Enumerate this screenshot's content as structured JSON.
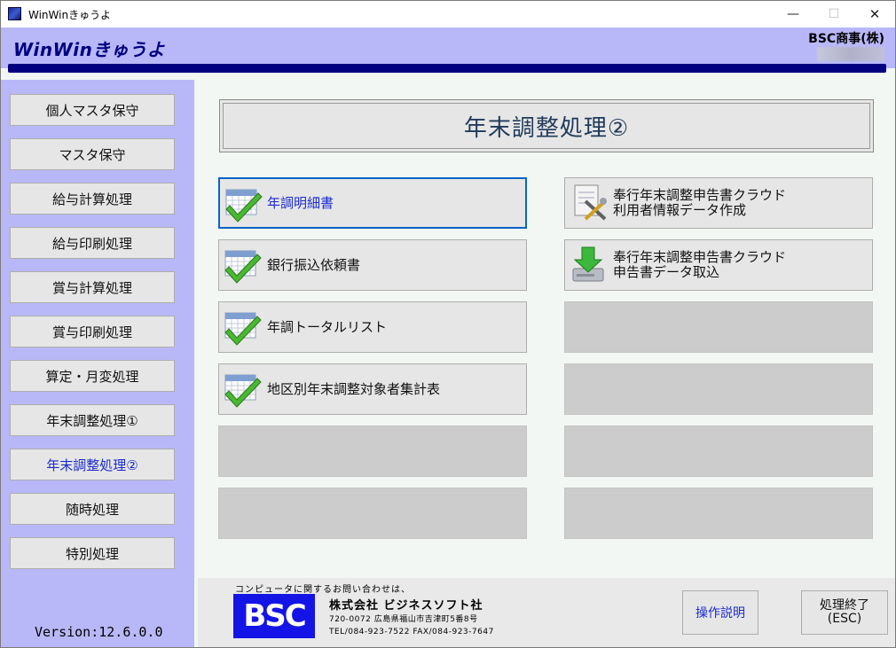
{
  "window": {
    "title": "WinWinきゅうよ",
    "minimize": "—",
    "maximize": "☐",
    "close": "✕"
  },
  "header": {
    "title": "WinWinきゅうよ",
    "company": "BSC商事(株)",
    "accent_color": "#000080",
    "band_color": "#b8b8f8"
  },
  "sidebar": {
    "items": [
      {
        "label": "個人マスタ保守"
      },
      {
        "label": "マスタ保守"
      },
      {
        "label": "給与計算処理"
      },
      {
        "label": "給与印刷処理"
      },
      {
        "label": "賞与計算処理"
      },
      {
        "label": "賞与印刷処理"
      },
      {
        "label": "算定・月変処理"
      },
      {
        "label": "年末調整処理①"
      },
      {
        "label": "年末調整処理②",
        "active": true
      },
      {
        "label": "随時処理"
      },
      {
        "label": "特別処理"
      }
    ],
    "version": "Version:12.6.0.0"
  },
  "main": {
    "title": "年末調整処理②",
    "left_buttons": [
      {
        "label": "年調明細書",
        "icon": "calendar-check-icon",
        "focused": true
      },
      {
        "label": "銀行振込依頼書",
        "icon": "calendar-check-icon"
      },
      {
        "label": "年調トータルリスト",
        "icon": "calendar-check-icon"
      },
      {
        "label": "地区別年末調整対象者集計表",
        "icon": "calendar-check-icon"
      },
      {
        "label": ""
      },
      {
        "label": ""
      }
    ],
    "right_buttons": [
      {
        "label": "奉行年末調整申告書クラウド\n利用者情報データ作成",
        "icon": "document-tools-icon"
      },
      {
        "label": "奉行年末調整申告書クラウド\n申告書データ取込",
        "icon": "download-drive-icon"
      },
      {
        "label": ""
      },
      {
        "label": ""
      },
      {
        "label": ""
      },
      {
        "label": ""
      }
    ]
  },
  "footer": {
    "contact_note": "コンピュータに関するお問い合わせは、",
    "logo_text": "BSC",
    "company": "株式会社 ビジネスソフト社",
    "address": "720-0072  広島県福山市吉津町5番8号",
    "tel": "TEL/084-923-7522  FAX/084-923-7647",
    "help_label": "操作説明",
    "exit_label": "処理終了",
    "exit_sub": "(ESC)"
  }
}
